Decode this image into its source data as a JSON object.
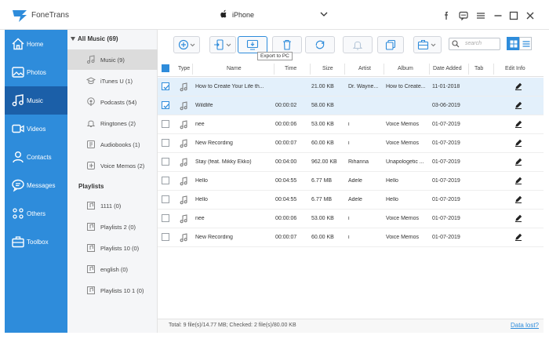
{
  "app": {
    "name": "FoneTrans",
    "device_name": "iPhone"
  },
  "sidebar": {
    "items": [
      {
        "label": "Home",
        "icon": "home-icon"
      },
      {
        "label": "Photos",
        "icon": "photos-icon"
      },
      {
        "label": "Music",
        "icon": "music-icon",
        "active": true
      },
      {
        "label": "Videos",
        "icon": "videos-icon"
      },
      {
        "label": "Contacts",
        "icon": "contacts-icon"
      },
      {
        "label": "Messages",
        "icon": "messages-icon"
      },
      {
        "label": "Others",
        "icon": "others-icon"
      },
      {
        "label": "Toolbox",
        "icon": "toolbox-icon"
      }
    ]
  },
  "categories": {
    "header": "All Music (69)",
    "items": [
      {
        "label": "Music (9)",
        "active": true
      },
      {
        "label": "iTunes U (1)"
      },
      {
        "label": "Podcasts (54)"
      },
      {
        "label": "Ringtones (2)"
      },
      {
        "label": "Audiobooks (1)"
      },
      {
        "label": "Voice Memos (2)"
      }
    ],
    "playlists_header": "Playlists",
    "playlists": [
      {
        "label": "1111 (0)"
      },
      {
        "label": "Playlists 2 (0)"
      },
      {
        "label": "Playlists 10 (0)"
      },
      {
        "label": "english (0)"
      },
      {
        "label": "Playlists 10 1 (0)"
      }
    ]
  },
  "toolbar": {
    "tooltip": "Export to PC",
    "search_placeholder": "search"
  },
  "table": {
    "headers": {
      "type": "Type",
      "name": "Name",
      "time": "Time",
      "size": "Size",
      "artist": "Artist",
      "album": "Album",
      "date_added": "Date Added",
      "tab": "Tab",
      "edit_info": "Edit Info"
    },
    "rows": [
      {
        "checked": true,
        "name": "How to Create Your Life th...",
        "time": "",
        "size": "21.00 KB",
        "artist": "Dr. Wayne...",
        "album": "How to Create...",
        "date": "11-01-2018"
      },
      {
        "checked": true,
        "name": "Wildlife",
        "time": "00:00:02",
        "size": "58.00 KB",
        "artist": "",
        "album": "",
        "date": "03-06-2019"
      },
      {
        "checked": false,
        "name": "nee",
        "time": "00:00:06",
        "size": "53.00 KB",
        "artist": "i",
        "album": "Voice Memos",
        "date": "01-07-2019"
      },
      {
        "checked": false,
        "name": "New Recording",
        "time": "00:00:07",
        "size": "60.00 KB",
        "artist": "i",
        "album": "Voice Memos",
        "date": "01-07-2019"
      },
      {
        "checked": false,
        "name": "Stay (feat. Mikky Ekko)",
        "time": "00:04:00",
        "size": "962.00 KB",
        "artist": "Rihanna",
        "album": "Unapologetic ...",
        "date": "01-07-2019"
      },
      {
        "checked": false,
        "name": "Hello",
        "time": "00:04:55",
        "size": "6.77 MB",
        "artist": "Adele",
        "album": "Hello",
        "date": "01-07-2019"
      },
      {
        "checked": false,
        "name": "Hello",
        "time": "00:04:55",
        "size": "6.77 MB",
        "artist": "Adele",
        "album": "Hello",
        "date": "01-07-2019"
      },
      {
        "checked": false,
        "name": "nee",
        "time": "00:00:06",
        "size": "53.00 KB",
        "artist": "i",
        "album": "Voice Memos",
        "date": "01-07-2019"
      },
      {
        "checked": false,
        "name": "New Recording",
        "time": "00:00:07",
        "size": "60.00 KB",
        "artist": "i",
        "album": "Voice Memos",
        "date": "01-07-2019"
      }
    ]
  },
  "status": {
    "summary": "Total: 9 file(s)/14.77 MB; Checked: 2 file(s)/80.00 KB",
    "data_lost_link": "Data lost?"
  },
  "colors": {
    "accent": "#2e8cdb",
    "sidebar_active": "#1b5fa8",
    "row_checked": "#e3f0fb"
  }
}
